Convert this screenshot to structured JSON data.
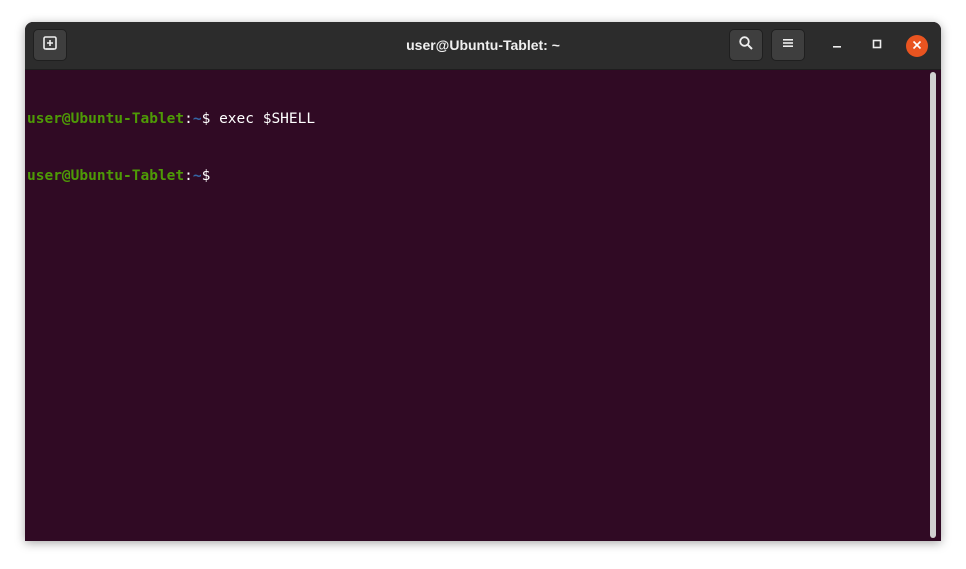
{
  "window": {
    "title": "user@Ubuntu-Tablet: ~"
  },
  "titlebar": {
    "new_tab_icon": "new-tab-icon",
    "search_icon": "search-icon",
    "menu_icon": "hamburger-menu-icon",
    "minimize_icon": "minimize-icon",
    "maximize_icon": "maximize-icon",
    "close_icon": "close-icon"
  },
  "terminal": {
    "lines": [
      {
        "user_host": "user@Ubuntu-Tablet",
        "colon": ":",
        "path": "~",
        "dollar": "$",
        "command": " exec $SHELL"
      },
      {
        "user_host": "user@Ubuntu-Tablet",
        "colon": ":",
        "path": "~",
        "dollar": "$",
        "command": ""
      }
    ]
  },
  "colors": {
    "terminal_background": "#300a24",
    "prompt_user_host": "#4e9a06",
    "prompt_path": "#3465a4",
    "close_button": "#e95420",
    "titlebar": "#2c2c2c"
  }
}
